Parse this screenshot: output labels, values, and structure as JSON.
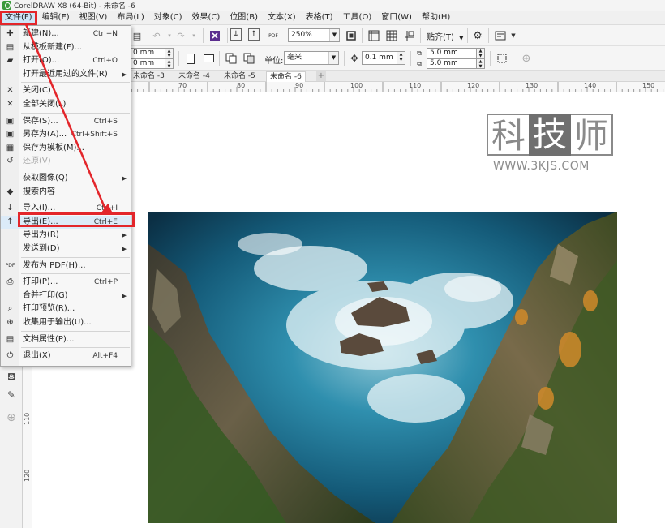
{
  "window": {
    "title": "CorelDRAW X8 (64-Bit) - 未命名 -6"
  },
  "menubar": {
    "items": [
      "文件(F)",
      "编辑(E)",
      "视图(V)",
      "布局(L)",
      "对象(C)",
      "效果(C)",
      "位图(B)",
      "文本(X)",
      "表格(T)",
      "工具(O)",
      "窗口(W)",
      "帮助(H)"
    ]
  },
  "toolbar": {
    "zoom_value": "250%",
    "pdf_label": "PDF",
    "snap_label": "贴齐(T)",
    "width_value": "0 mm",
    "height_value": "0 mm",
    "unit_label": "单位:",
    "unit_value": "毫米",
    "nudge_value": "0.1 mm",
    "dup_x_value": "5.0 mm",
    "dup_y_value": "5.0 mm"
  },
  "doc_tabs": [
    "未命名 -3",
    "未命名 -4",
    "未命名 -5",
    "未命名 -6"
  ],
  "ruler": {
    "h_labels": [
      "70",
      "80",
      "90",
      "100",
      "110",
      "120",
      "130",
      "140",
      "150"
    ],
    "v_labels": [
      "110",
      "120"
    ]
  },
  "file_menu": {
    "items": [
      {
        "label": "新建(N)...",
        "shortcut": "Ctrl+N",
        "icon": "new-doc-icon",
        "glyph": "✚"
      },
      {
        "label": "从模板新建(F)...",
        "shortcut": "",
        "icon": "template-icon",
        "glyph": "▤"
      },
      {
        "label": "打开(O)...",
        "shortcut": "Ctrl+O",
        "icon": "open-folder-icon",
        "glyph": "▰"
      },
      {
        "label": "打开最近用过的文件(R)",
        "shortcut": "",
        "icon": "",
        "glyph": "",
        "submenu": true
      },
      {
        "label": "关闭(C)",
        "shortcut": "",
        "icon": "close-doc-icon",
        "glyph": "✕"
      },
      {
        "label": "全部关闭(L)",
        "shortcut": "",
        "icon": "close-all-icon",
        "glyph": "✕"
      },
      {
        "label": "保存(S)...",
        "shortcut": "Ctrl+S",
        "icon": "save-icon",
        "glyph": "▣"
      },
      {
        "label": "另存为(A)...",
        "shortcut": "Ctrl+Shift+S",
        "icon": "save-as-icon",
        "glyph": "▣"
      },
      {
        "label": "保存为模板(M)...",
        "shortcut": "",
        "icon": "save-template-icon",
        "glyph": "▦"
      },
      {
        "label": "还原(V)",
        "shortcut": "",
        "icon": "revert-icon",
        "glyph": "↺",
        "disabled": true
      },
      {
        "label": "获取图像(Q)",
        "shortcut": "",
        "icon": "",
        "glyph": "",
        "submenu": true
      },
      {
        "label": "搜索内容",
        "shortcut": "",
        "icon": "search-content-icon",
        "glyph": "◆"
      },
      {
        "label": "导入(I)...",
        "shortcut": "Ctrl+I",
        "icon": "import-icon",
        "glyph": "↓"
      },
      {
        "label": "导出(E)...",
        "shortcut": "Ctrl+E",
        "icon": "export-icon",
        "glyph": "↑"
      },
      {
        "label": "导出为(R)",
        "shortcut": "",
        "icon": "",
        "glyph": "",
        "submenu": true
      },
      {
        "label": "发送到(D)",
        "shortcut": "",
        "icon": "",
        "glyph": "",
        "submenu": true
      },
      {
        "label": "发布为 PDF(H)...",
        "shortcut": "",
        "icon": "pdf-icon",
        "glyph": "PDF"
      },
      {
        "label": "打印(P)...",
        "shortcut": "Ctrl+P",
        "icon": "print-icon",
        "glyph": "⎙"
      },
      {
        "label": "合并打印(G)",
        "shortcut": "",
        "icon": "",
        "glyph": "",
        "submenu": true
      },
      {
        "label": "打印预览(R)...",
        "shortcut": "",
        "icon": "print-preview-icon",
        "glyph": "⌕"
      },
      {
        "label": "收集用于输出(U)...",
        "shortcut": "",
        "icon": "collect-output-icon",
        "glyph": "⊕"
      },
      {
        "label": "文档属性(P)...",
        "shortcut": "",
        "icon": "doc-properties-icon",
        "glyph": "▤"
      },
      {
        "label": "退出(X)",
        "shortcut": "Alt+F4",
        "icon": "exit-icon",
        "glyph": "⏻"
      }
    ]
  },
  "watermark": {
    "chars": [
      "科",
      "技",
      "师"
    ],
    "url": "WWW.3KJS.COM"
  },
  "colors": {
    "annotation": "#e3262b",
    "water": "#1f6f8c",
    "rock": "#5a5040"
  }
}
